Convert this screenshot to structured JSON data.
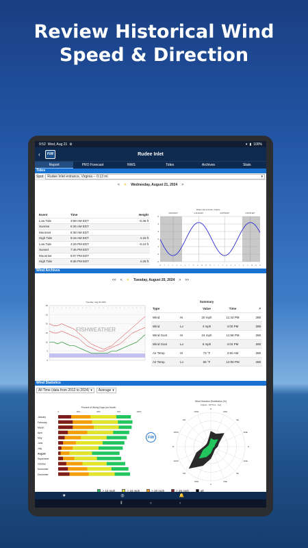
{
  "headline": {
    "line1": "Review Historical Wind",
    "line2": "Speed & Direction"
  },
  "status": {
    "time": "9:52",
    "date": "Wed, Aug 21",
    "battery": "100%"
  },
  "app": {
    "title": "Rudee Inlet",
    "logo": "FiW"
  },
  "tabs": [
    "Report",
    "PRO Forecast",
    "NWS",
    "Tides",
    "Archives",
    "Stats"
  ],
  "tides": {
    "header": "Tides",
    "spot_label": "Spot",
    "spot_value": "Rudee Inlet entrance, Virginia -- 0.13 mi",
    "date": "Wednesday, August 21, 2024",
    "columns": [
      "Event",
      "Time",
      "Height"
    ],
    "rows": [
      [
        "Low Tide",
        "3:08 AM EDT",
        "-0.36 ft"
      ],
      [
        "Sunrise",
        "6:26 AM EDT",
        ""
      ],
      [
        "Moonset",
        "8:38 AM EDT",
        ""
      ],
      [
        "High Tide",
        "9:16 AM EDT",
        "4.15 ft"
      ],
      [
        "Low Tide",
        "3:29 PM EDT",
        "-0.24 ft"
      ],
      [
        "Sunset",
        "7:46 PM EDT",
        ""
      ],
      [
        "Moonrise",
        "9:07 PM EDT",
        ""
      ],
      [
        "High Tide",
        "9:36 PM EDT",
        "4.25 ft"
      ]
    ]
  },
  "archives": {
    "header": "Wind Archives",
    "date": "Tuesday, August 20, 2024",
    "nav": {
      "first": "<<",
      "prev": "<",
      "next": ">",
      "last": ">>"
    },
    "chart_title": "Tuesday, Aug 20 2024",
    "watermark": "FISHWEATHER",
    "summary_title": "Summary",
    "columns": [
      "Type",
      "",
      "Value",
      "Time",
      "#"
    ],
    "rows": [
      [
        "Wind",
        "Hi",
        "20 mph",
        "11:43 PM",
        "288"
      ],
      [
        "Wind",
        "Lo",
        "4 mph",
        "4:00 PM",
        "288"
      ],
      [
        "Wind Gust",
        "Hi",
        "24 mph",
        "11:58 PM",
        "288"
      ],
      [
        "Wind Gust",
        "Lo",
        "5 mph",
        "4:04 PM",
        "288"
      ],
      [
        "Air Temp",
        "Hi",
        "73 °F",
        "2:50 AM",
        "288"
      ],
      [
        "Air Temp",
        "Lo",
        "66 °F",
        "12:08 PM",
        "288"
      ]
    ]
  },
  "stats": {
    "header": "Wind Statistics",
    "range": "All Time (data from 2012 to 2024)",
    "agg": "Average",
    "bar_title": "Percent of Windy Days per Month",
    "rose_title": "Wind Direction Distribution (%)",
    "rose_subtitle": "August - All Time - Avg",
    "badge": "FiW",
    "legend": [
      {
        "label": "> 10 mph",
        "color": "#22c55e"
      },
      {
        "label": "> 15 mph",
        "color": "#e4e42a"
      },
      {
        "label": "> 20 mph",
        "color": "#f59e0b"
      },
      {
        "label": "> 25 mph",
        "color": "#7f1d1d"
      },
      {
        "label": "all",
        "color": "#000000"
      }
    ],
    "ticks": [
      "0",
      "25%",
      "50%",
      "75%",
      "100%"
    ],
    "directions": [
      "N",
      "NNE",
      "NE",
      "ENE",
      "E",
      "ESE",
      "SE",
      "SSE",
      "S",
      "SSW",
      "SW",
      "WSW",
      "W",
      "WNW",
      "NW",
      "NNW"
    ]
  },
  "chart_data": [
    {
      "type": "line",
      "title": "Rudee Inlet entrance, Virginia",
      "xlabel": "",
      "ylabel": "",
      "x": [
        "0:00",
        "3:08",
        "9:16",
        "15:29",
        "21:36",
        "24:00"
      ],
      "series": [
        {
          "values": [
            1.0,
            -0.36,
            4.15,
            -0.24,
            4.25,
            3.0
          ]
        }
      ],
      "ylim": [
        -1,
        5
      ],
      "yticks": [
        "5",
        "4",
        "3",
        "2",
        "1",
        "0",
        "-1"
      ],
      "annotations": [
        "3:08 AM EDT",
        "9:16 AM EDT",
        "3:29 PM EDT",
        "9:36 PM EDT"
      ]
    },
    {
      "type": "line",
      "title": "Tuesday, Aug 20 2024",
      "ylim": [
        0,
        30
      ],
      "yticks": [
        "30",
        "25",
        "20",
        "15",
        "10",
        "5",
        "0"
      ],
      "series": [
        {
          "values": [
            16,
            15,
            15,
            16,
            15,
            14,
            13,
            12,
            10,
            8,
            7,
            6,
            5,
            5,
            6,
            7,
            8,
            9,
            11,
            13,
            15,
            16,
            17,
            18
          ]
        },
        {
          "values": [
            10,
            10,
            9,
            10,
            9,
            8,
            8,
            7,
            6,
            5,
            4,
            4,
            4,
            4,
            4,
            5,
            5,
            6,
            7,
            8,
            9,
            10,
            12,
            14
          ]
        },
        {
          "values": [
            20,
            19,
            19,
            20,
            19,
            18,
            17,
            15,
            13,
            11,
            9,
            8,
            7,
            6,
            7,
            8,
            10,
            12,
            14,
            16,
            18,
            20,
            22,
            24
          ]
        }
      ]
    },
    {
      "type": "bar",
      "title": "Percent of Windy Days per Month",
      "categories": [
        "January",
        "February",
        "March",
        "April",
        "May",
        "June",
        "July",
        "August",
        "September",
        "October",
        "November",
        "December"
      ],
      "series": [
        {
          "name": "> 10 mph",
          "values": [
            90,
            92,
            91,
            88,
            85,
            82,
            80,
            76,
            78,
            83,
            87,
            89
          ]
        },
        {
          "name": "> 15 mph",
          "values": [
            72,
            74,
            75,
            68,
            60,
            55,
            50,
            42,
            48,
            60,
            66,
            70
          ]
        },
        {
          "name": "> 20 mph",
          "values": [
            40,
            42,
            44,
            36,
            28,
            22,
            18,
            14,
            20,
            30,
            36,
            38
          ]
        },
        {
          "name": "> 25 mph",
          "values": [
            16,
            18,
            18,
            12,
            8,
            6,
            4,
            3,
            6,
            10,
            12,
            14
          ]
        }
      ],
      "xlim": [
        0,
        100
      ]
    },
    {
      "type": "scatter",
      "title": "Wind Direction Distribution (%)",
      "categories": [
        "N",
        "NNE",
        "NE",
        "ENE",
        "E",
        "ESE",
        "SE",
        "SSE",
        "S",
        "SSW",
        "SW",
        "WSW",
        "W",
        "WNW",
        "NW",
        "NNW"
      ],
      "values": [
        9,
        8,
        11,
        5,
        4,
        3,
        3,
        4,
        7,
        12,
        18,
        9,
        4,
        3,
        3,
        4
      ]
    }
  ]
}
